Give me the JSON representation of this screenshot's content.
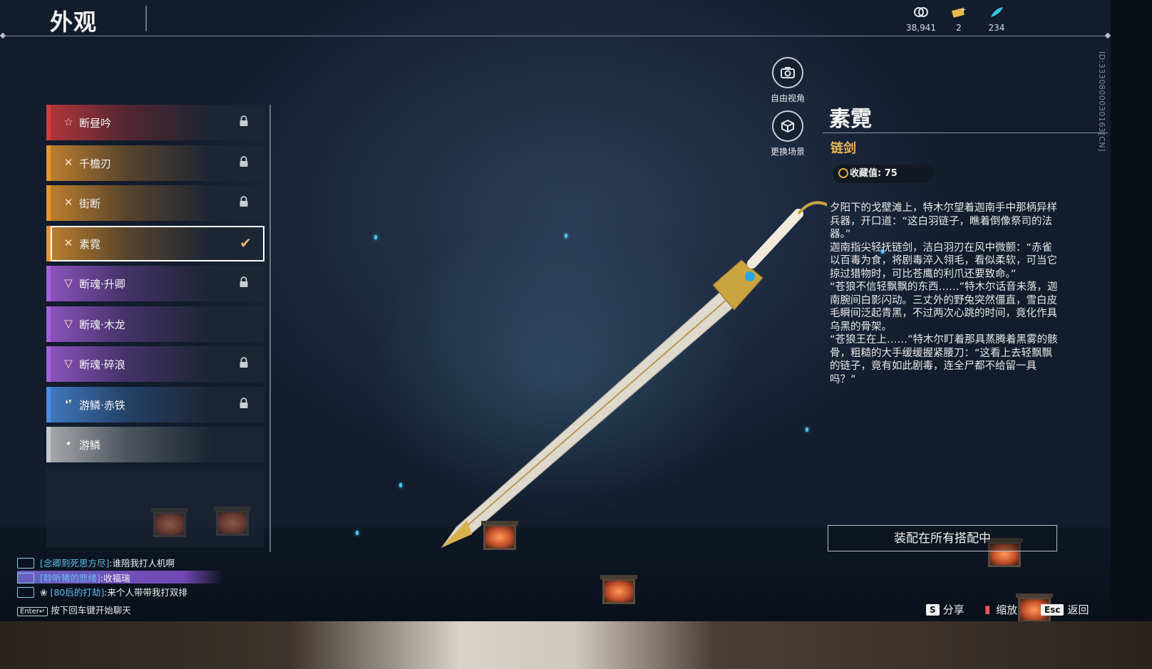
{
  "header": {
    "title": "外观",
    "currencies": [
      {
        "icon": "coin-stack-icon",
        "value": "38,941"
      },
      {
        "icon": "ticket-icon",
        "value": "2"
      },
      {
        "icon": "feather-icon",
        "value": "234"
      }
    ],
    "uid": "ID:3330800030163[CN]"
  },
  "skins": [
    {
      "name": "断昼吟",
      "icon": "star-icon",
      "color": "#d63c3c",
      "locked": true,
      "selected": false
    },
    {
      "name": "千檐刃",
      "icon": "x-blades-icon",
      "color": "#e6962e",
      "locked": true,
      "selected": false
    },
    {
      "name": "街断",
      "icon": "x-blades-icon",
      "color": "#e6962e",
      "locked": true,
      "selected": false
    },
    {
      "name": "素霓",
      "icon": "x-blades-icon",
      "color": "#e6962e",
      "locked": false,
      "selected": true
    },
    {
      "name": "断魂·升卿",
      "icon": "wing-icon",
      "color": "#a860e0",
      "locked": true,
      "selected": false
    },
    {
      "name": "断魂·木龙",
      "icon": "wing-icon",
      "color": "#a860e0",
      "locked": false,
      "selected": false
    },
    {
      "name": "断魂·碎浪",
      "icon": "wing-icon",
      "color": "#a860e0",
      "locked": true,
      "selected": false
    },
    {
      "name": "游鳞·赤铁",
      "icon": "fin-icon",
      "color": "#4a8ee0",
      "locked": true,
      "selected": false
    },
    {
      "name": "游鳞",
      "icon": "drop-icon",
      "color": "#c8c8c8",
      "locked": false,
      "selected": false
    }
  ],
  "side_buttons": {
    "free_view": "自由视角",
    "change_scene": "更换场景"
  },
  "detail": {
    "name": "素霓",
    "type": "链剑",
    "collection": "收藏值: 75",
    "description": [
      "夕阳下的戈壁滩上，特木尔望着迦南手中那柄异样兵器，开口道：“这白羽链子，瞧着倒像祭司的法器。”",
      "迦南指尖轻抚链剑，洁白羽刃在风中微颤：“赤雀以百毒为食，将剧毒淬入翎毛，看似柔软，可当它掠过猎物时，可比苍鹰的利爪还要致命。”",
      "“苍狼不信轻飘飘的东西……”特木尔话音未落，迦南腕间白影闪动。三丈外的野兔突然僵直，雪白皮毛瞬间泛起青黑，不过两次心跳的时间，竟化作具乌黑的骨架。",
      "“苍狼王在上……”特木尔盯着那具蒸腾着黑雾的骸骨，粗糙的大手缓缓握紧腰刀：“这看上去轻飘飘的链子，竟有如此剧毒，连全尸都不给留一具吗？”"
    ],
    "equip_button": "装配在所有搭配中"
  },
  "chat": {
    "lines": [
      {
        "who": "[念卿到死思方尽]",
        "msg": ":谁陪我打人机啊"
      },
      {
        "who": "[聆听猪的悲绪]",
        "msg": ":收福瑞"
      },
      {
        "who": "[80后的打劫]",
        "msg": ":来个人带带我打双排"
      }
    ],
    "hint_key": "Enter↵",
    "hint": "按下回车键开始聊天"
  },
  "footer": {
    "share_key": "S",
    "share": "分享",
    "zoom": "缩放",
    "back_key": "Esc",
    "back": "返回"
  }
}
